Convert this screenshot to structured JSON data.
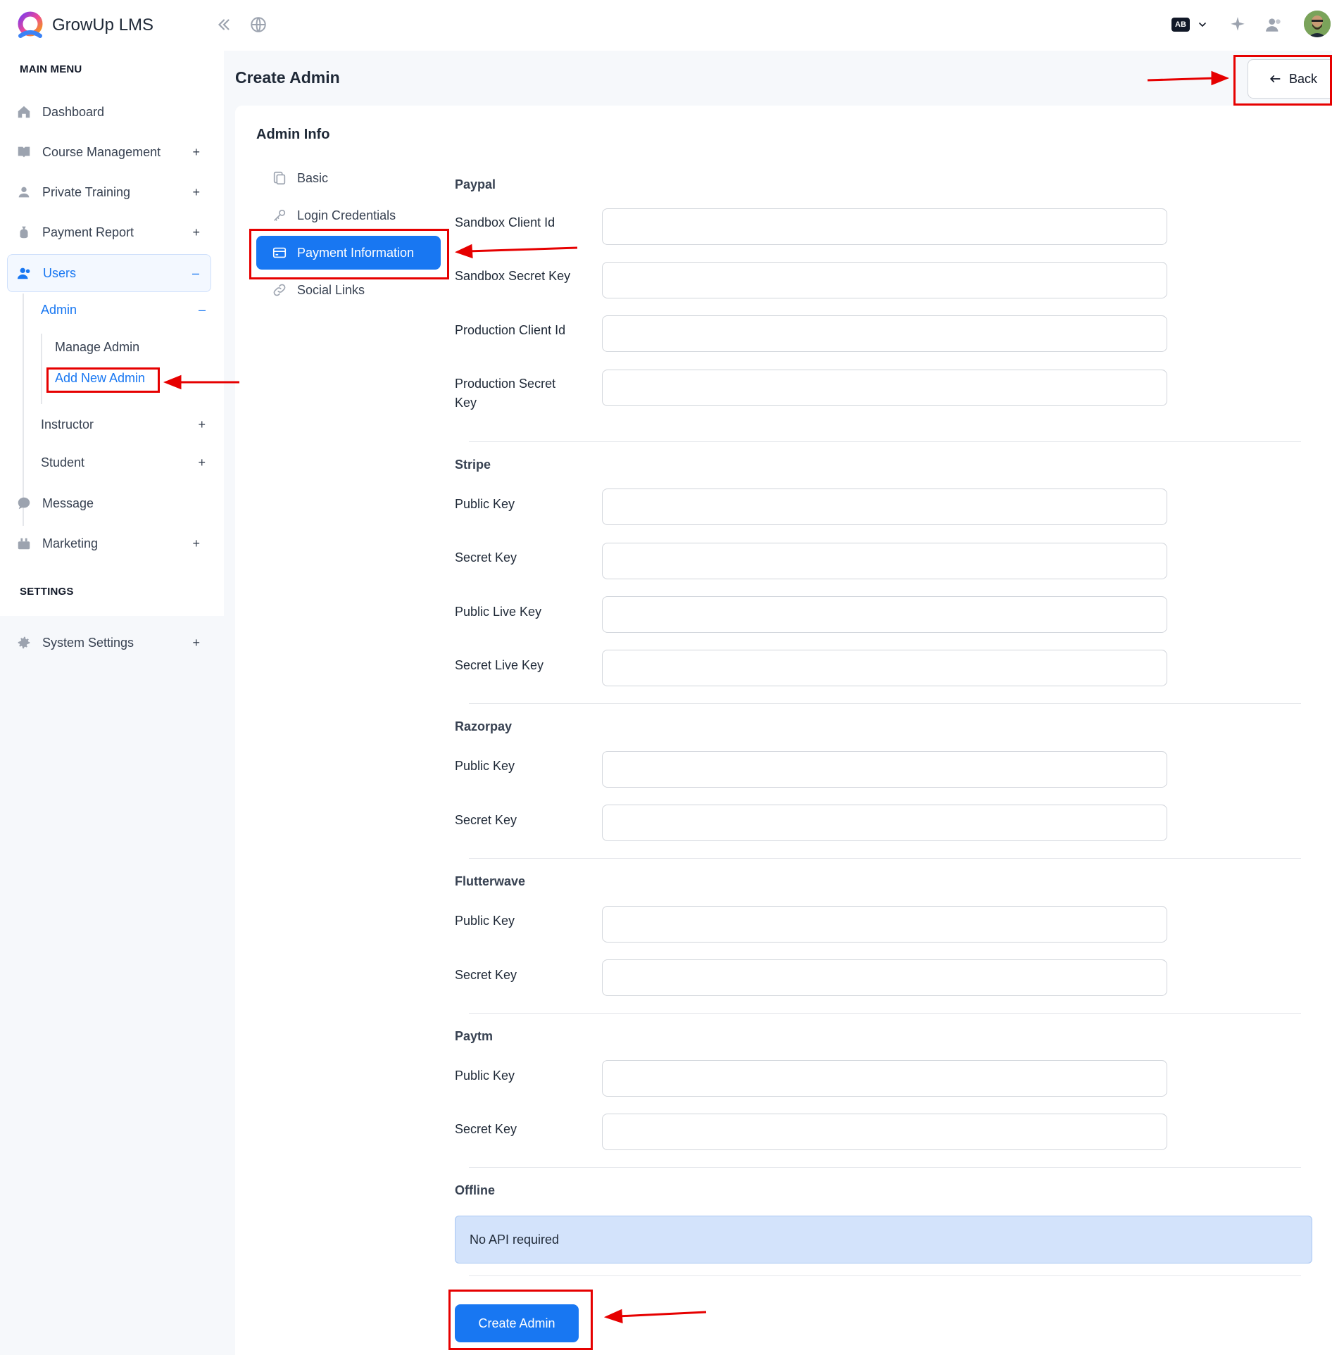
{
  "app": {
    "name": "GrowUp LMS",
    "lang_badge": "AB"
  },
  "topbar_icons": [
    "collapse-sidebar-icon",
    "globe-icon",
    "translate-icon",
    "sparkle-icon",
    "users-icon"
  ],
  "sidebar": {
    "main_menu_label": "MAIN MENU",
    "settings_label": "SETTINGS",
    "items": [
      {
        "label": "Dashboard",
        "icon": "home-icon",
        "toggle": ""
      },
      {
        "label": "Course Management",
        "icon": "book-icon",
        "toggle": "+"
      },
      {
        "label": "Private Training",
        "icon": "training-icon",
        "toggle": "+"
      },
      {
        "label": "Payment Report",
        "icon": "money-bag-icon",
        "toggle": "+"
      },
      {
        "label": "Users",
        "icon": "users-icon",
        "toggle": "–"
      },
      {
        "label": "Message",
        "icon": "message-icon",
        "toggle": ""
      },
      {
        "label": "Marketing",
        "icon": "marketing-icon",
        "toggle": "+"
      },
      {
        "label": "System Settings",
        "icon": "gear-icon",
        "toggle": "+"
      }
    ],
    "users_sub": [
      {
        "label": "Admin",
        "toggle": "–"
      },
      {
        "label": "Instructor",
        "toggle": "+"
      },
      {
        "label": "Student",
        "toggle": "+"
      }
    ],
    "admin_sub": [
      {
        "label": "Manage Admin"
      },
      {
        "label": "Add New Admin"
      }
    ]
  },
  "header": {
    "title": "Create Admin",
    "back_label": "Back"
  },
  "card": {
    "title": "Admin Info",
    "tabs": [
      {
        "label": "Basic",
        "icon": "copy-icon"
      },
      {
        "label": "Login Credentials",
        "icon": "key-icon"
      },
      {
        "label": "Payment Information",
        "icon": "credit-card-icon"
      },
      {
        "label": "Social Links",
        "icon": "link-icon"
      }
    ]
  },
  "payment": {
    "paypal": {
      "title": "Paypal",
      "fields": [
        {
          "label": "Sandbox Client Id",
          "value": ""
        },
        {
          "label": "Sandbox Secret Key",
          "value": ""
        },
        {
          "label": "Production Client Id",
          "value": ""
        },
        {
          "label": "Production Secret Key",
          "value": ""
        }
      ]
    },
    "stripe": {
      "title": "Stripe",
      "fields": [
        {
          "label": "Public Key",
          "value": ""
        },
        {
          "label": "Secret Key",
          "value": ""
        },
        {
          "label": "Public Live Key",
          "value": ""
        },
        {
          "label": "Secret Live Key",
          "value": ""
        }
      ]
    },
    "razorpay": {
      "title": "Razorpay",
      "fields": [
        {
          "label": "Public Key",
          "value": ""
        },
        {
          "label": "Secret Key",
          "value": ""
        }
      ]
    },
    "flutterwave": {
      "title": "Flutterwave",
      "fields": [
        {
          "label": "Public Key",
          "value": ""
        },
        {
          "label": "Secret Key",
          "value": ""
        }
      ]
    },
    "paytm": {
      "title": "Paytm",
      "fields": [
        {
          "label": "Public Key",
          "value": ""
        },
        {
          "label": "Secret Key",
          "value": ""
        }
      ]
    },
    "offline": {
      "title": "Offline",
      "note": "No API required"
    }
  },
  "submit_label": "Create Admin",
  "colors": {
    "primary": "#1877f2",
    "annotation": "#e60000",
    "info_bg": "#d3e3fb"
  }
}
